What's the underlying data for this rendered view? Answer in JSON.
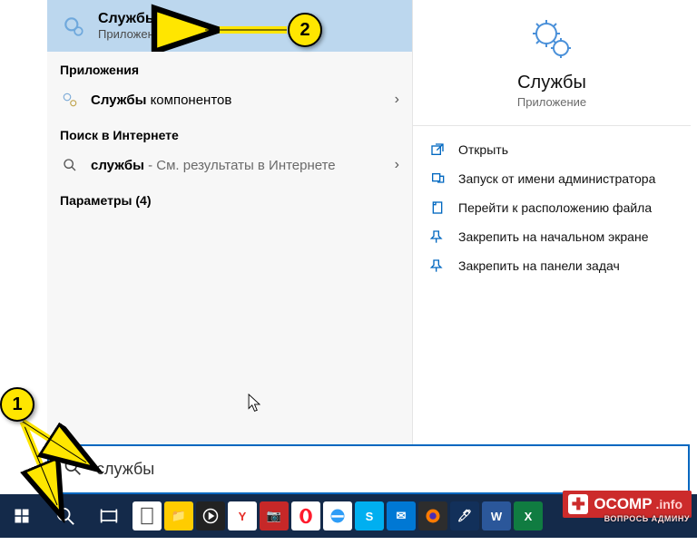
{
  "best_match": {
    "title": "Службы",
    "subtitle": "Приложение"
  },
  "groups": {
    "apps_header": "Приложения",
    "apps_item_bold": "Службы",
    "apps_item_rest": " компонентов",
    "web_header": "Поиск в Интернете",
    "web_item_bold": "службы",
    "web_item_suffix": " - См. результаты в Интернете",
    "settings_header": "Параметры (4)"
  },
  "preview": {
    "title": "Службы",
    "subtitle": "Приложение",
    "actions": [
      "Открыть",
      "Запуск от имени администратора",
      "Перейти к расположению файла",
      "Закрепить на начальном экране",
      "Закрепить на панели задач"
    ]
  },
  "search": {
    "value": "службы"
  },
  "annotations": {
    "step1": "1",
    "step2": "2"
  },
  "watermark": {
    "brand_main": "OCOMP",
    "brand_suffix": " .info",
    "tagline": "ВОПРОСЬ АДМИНУ"
  }
}
